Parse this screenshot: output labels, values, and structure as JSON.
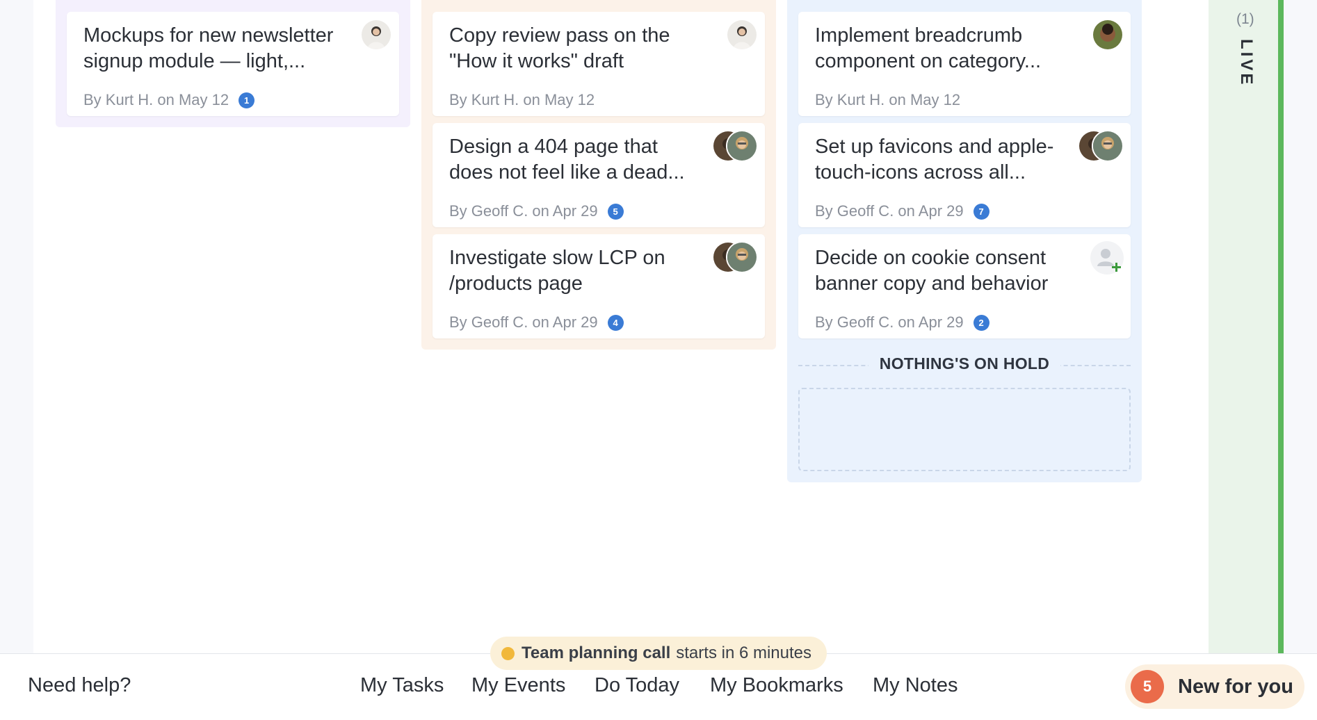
{
  "columns": [
    {
      "cards": [
        {
          "title": "Mockups for new newsletter signup module — light,...",
          "meta": "By Kurt H. on May 12",
          "badge": "1"
        }
      ]
    },
    {
      "cards": [
        {
          "title": "Copy review pass on the \"How it works\" draft",
          "meta": "By Kurt H. on May 12",
          "badge": ""
        },
        {
          "title": "Design a 404 page that does not feel like a dead...",
          "meta": "By Geoff C. on Apr 29",
          "badge": "5"
        },
        {
          "title": "Investigate slow LCP on /products page",
          "meta": "By Geoff C. on Apr 29",
          "badge": "4"
        }
      ]
    },
    {
      "cards": [
        {
          "title": "Implement breadcrumb component on category...",
          "meta": "By Kurt H. on May 12",
          "badge": ""
        },
        {
          "title": "Set up favicons and apple-touch-icons across all...",
          "meta": "By Geoff C. on Apr 29",
          "badge": "7"
        },
        {
          "title": "Decide on cookie consent banner copy and behavior",
          "meta": "By Geoff C. on Apr 29",
          "badge": "2"
        }
      ],
      "on_hold_label": "NOTHING'S ON HOLD"
    }
  ],
  "live": {
    "count": "(1)",
    "label": "LIVE"
  },
  "event": {
    "name": "Team planning call",
    "text": "starts in 6 minutes"
  },
  "footer": {
    "help": "Need help?",
    "nav": [
      "My Tasks",
      "My Events",
      "Do Today",
      "My Bookmarks",
      "My Notes"
    ],
    "new_count": "5",
    "new_label": "New for you"
  },
  "colors": {
    "accent_blue": "#3a7bd5",
    "live_green": "#5cb85c",
    "new_badge": "#ea6b4a"
  }
}
